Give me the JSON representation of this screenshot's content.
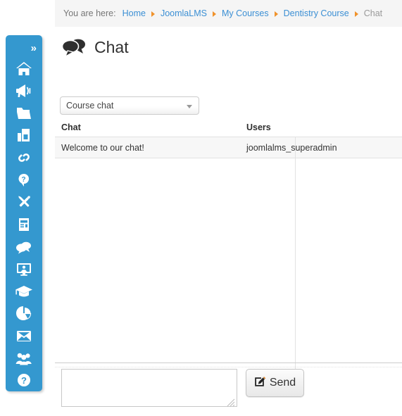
{
  "breadcrumb": {
    "lead": "You are here:",
    "items": [
      {
        "label": "Home",
        "current": false
      },
      {
        "label": "JoomlaLMS",
        "current": false
      },
      {
        "label": "My Courses",
        "current": false
      },
      {
        "label": "Dentistry Course",
        "current": false
      },
      {
        "label": "Chat",
        "current": true
      }
    ]
  },
  "sidebar": {
    "toggle_label": "»",
    "items": [
      {
        "icon": "home-icon"
      },
      {
        "icon": "megaphone-icon"
      },
      {
        "icon": "folder-icon"
      },
      {
        "icon": "bar-chart-icon"
      },
      {
        "icon": "link-icon"
      },
      {
        "icon": "question-marker-icon"
      },
      {
        "icon": "tools-icon"
      },
      {
        "icon": "document-icon"
      },
      {
        "icon": "chat-bubbles-icon"
      },
      {
        "icon": "monitor-user-icon"
      },
      {
        "icon": "graduation-cap-icon"
      },
      {
        "icon": "pie-chart-icon"
      },
      {
        "icon": "envelope-icon"
      },
      {
        "icon": "users-group-icon"
      },
      {
        "icon": "help-circle-icon"
      }
    ]
  },
  "page": {
    "title": "Chat",
    "icon": "chat-bubbles-icon"
  },
  "chat_select": {
    "value": "Course chat",
    "options": [
      "Course chat"
    ]
  },
  "table": {
    "columns": [
      "Chat",
      "Users"
    ],
    "messages": [
      {
        "text": "Welcome to our chat!",
        "user": "joomlalms_superadmin"
      }
    ]
  },
  "composer": {
    "input_value": "",
    "input_placeholder": "",
    "send_label": "Send",
    "send_icon": "compose-icon"
  },
  "colors": {
    "sidebar": "#3498cf",
    "link": "#3b8fd4",
    "separator": "#f0922b",
    "breadcrumb_bg": "#f5f5f5",
    "row_bg": "#f7f7f7"
  }
}
